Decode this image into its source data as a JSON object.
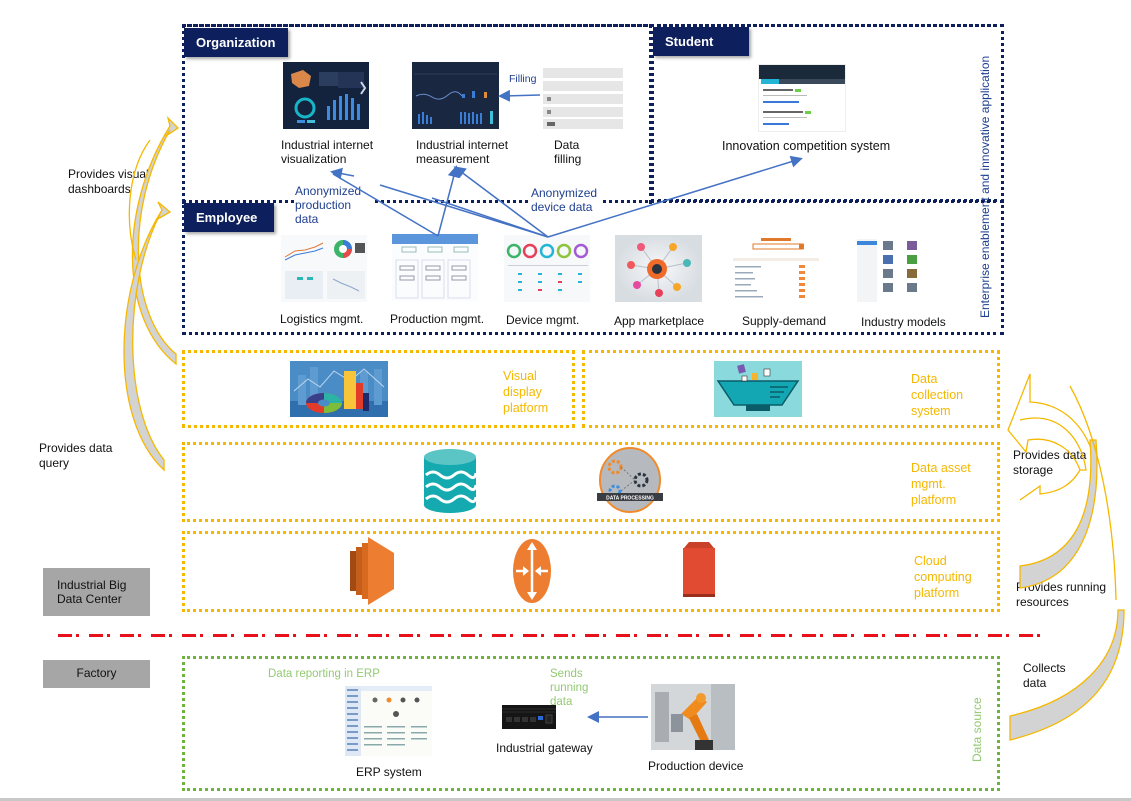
{
  "layers": {
    "enterprise_app": {
      "vertical_label": "Enterprise enablement and innovative application",
      "organization": {
        "tag": "Organization",
        "items": [
          {
            "label": "Industrial internet visualization"
          },
          {
            "label": "Industrial internet measurement"
          },
          {
            "label": "Data filling"
          }
        ],
        "filling_arrow_label": "Filling"
      },
      "student": {
        "tag": "Student",
        "items": [
          {
            "label": "Innovation competition system"
          }
        ]
      },
      "employee": {
        "tag": "Employee",
        "items": [
          {
            "label": "Logistics mgmt."
          },
          {
            "label": "Production mgmt."
          },
          {
            "label": "Device mgmt."
          },
          {
            "label": "App marketplace"
          },
          {
            "label": "Supply-demand"
          },
          {
            "label": "Industry models"
          }
        ]
      },
      "flow_labels": {
        "production": "Anonymized production data",
        "device": "Anonymized device data"
      }
    },
    "platforms": [
      {
        "name": "Visual display platform",
        "icon": "bar-pie-chart-icon"
      },
      {
        "name": "Data collection system",
        "icon": "funnel-bowl-icon"
      },
      {
        "name": "Data asset mgmt. platform",
        "icons": [
          "database-cylinder-icon",
          "data-processing-badge-icon"
        ],
        "badge_text": "DATA PROCESSING"
      },
      {
        "name": "Cloud computing platform",
        "icons": [
          "compute-server-icon",
          "router-icon",
          "storage-bucket-icon"
        ]
      }
    ],
    "data_source": {
      "vertical_label": "Data source",
      "erp_caption": "Data reporting in ERP",
      "erp_label": "ERP system",
      "gateway_caption": "Sends running data",
      "gateway_label": "Industrial gateway",
      "device_label": "Production device"
    }
  },
  "zones": {
    "upper": "Industrial Big Data Center",
    "lower": "Factory"
  },
  "side_flows": {
    "left": [
      {
        "label": "Provides visual dashboards"
      },
      {
        "label": "Provides data query"
      }
    ],
    "right": [
      {
        "label": "Provides data storage"
      },
      {
        "label": "Provides running resources"
      },
      {
        "label": "Collects data"
      }
    ]
  },
  "colors": {
    "navy": "#0d1f5c",
    "amber": "#f5b800",
    "green": "#6fb33f",
    "divider_red": "#e8101a",
    "flow_blue": "#4472c4"
  }
}
